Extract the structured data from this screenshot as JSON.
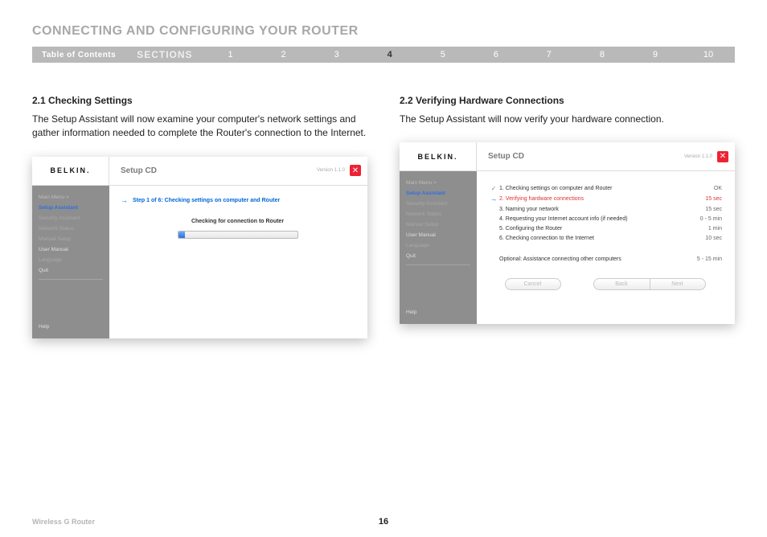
{
  "page_title": "CONNECTING AND CONFIGURING YOUR ROUTER",
  "nav": {
    "toc": "Table of Contents",
    "sections_label": "SECTIONS",
    "numbers": [
      "1",
      "2",
      "3",
      "4",
      "5",
      "6",
      "7",
      "8",
      "9",
      "10"
    ],
    "active": "4"
  },
  "left": {
    "heading": "2.1 Checking Settings",
    "body": "The Setup Assistant will now examine your computer's network settings and gather information needed to complete the Router's connection to the Internet."
  },
  "right": {
    "heading": "2.2 Verifying Hardware Connections",
    "body": "The Setup Assistant will now verify your hardware connection."
  },
  "panel_common": {
    "logo": "BELKIN.",
    "title": "Setup CD",
    "version": "Version 1.1.0",
    "close": "✕"
  },
  "sidebar": {
    "breadcrumb": "Main Menu  >",
    "items": {
      "setup_assistant": "Setup Assistant",
      "security_assistant": "Security Assistant",
      "network_status": "Network Status",
      "manual_setup": "Manual Setup",
      "user_manual": "User Manual",
      "language": "Language",
      "quit": "Quit",
      "help": "Help"
    }
  },
  "panel1": {
    "step_line": "Step 1 of 6: Checking settings on computer and Router",
    "checking": "Checking for connection to Router"
  },
  "panel2": {
    "steps": [
      {
        "icon": "check",
        "text": "1. Checking settings on computer and Router",
        "time": "OK"
      },
      {
        "icon": "arrow",
        "text": "2. Verifying hardware connections",
        "time": "15 sec",
        "current": true
      },
      {
        "icon": "",
        "text": "3. Naming your network",
        "time": "15 sec"
      },
      {
        "icon": "",
        "text": "4. Requesting your Internet account info (if needed)",
        "time": "0 - 5 min"
      },
      {
        "icon": "",
        "text": "5. Configuring the Router",
        "time": "1 min"
      },
      {
        "icon": "",
        "text": "6. Checking connection to the Internet",
        "time": "10 sec"
      }
    ],
    "optional": {
      "text": "Optional: Assistance connecting other computers",
      "time": "5 - 15 min"
    },
    "buttons": {
      "cancel": "Cancel",
      "back": "Back",
      "next": "Next"
    }
  },
  "footer": {
    "left": "Wireless G Router",
    "page": "16"
  }
}
